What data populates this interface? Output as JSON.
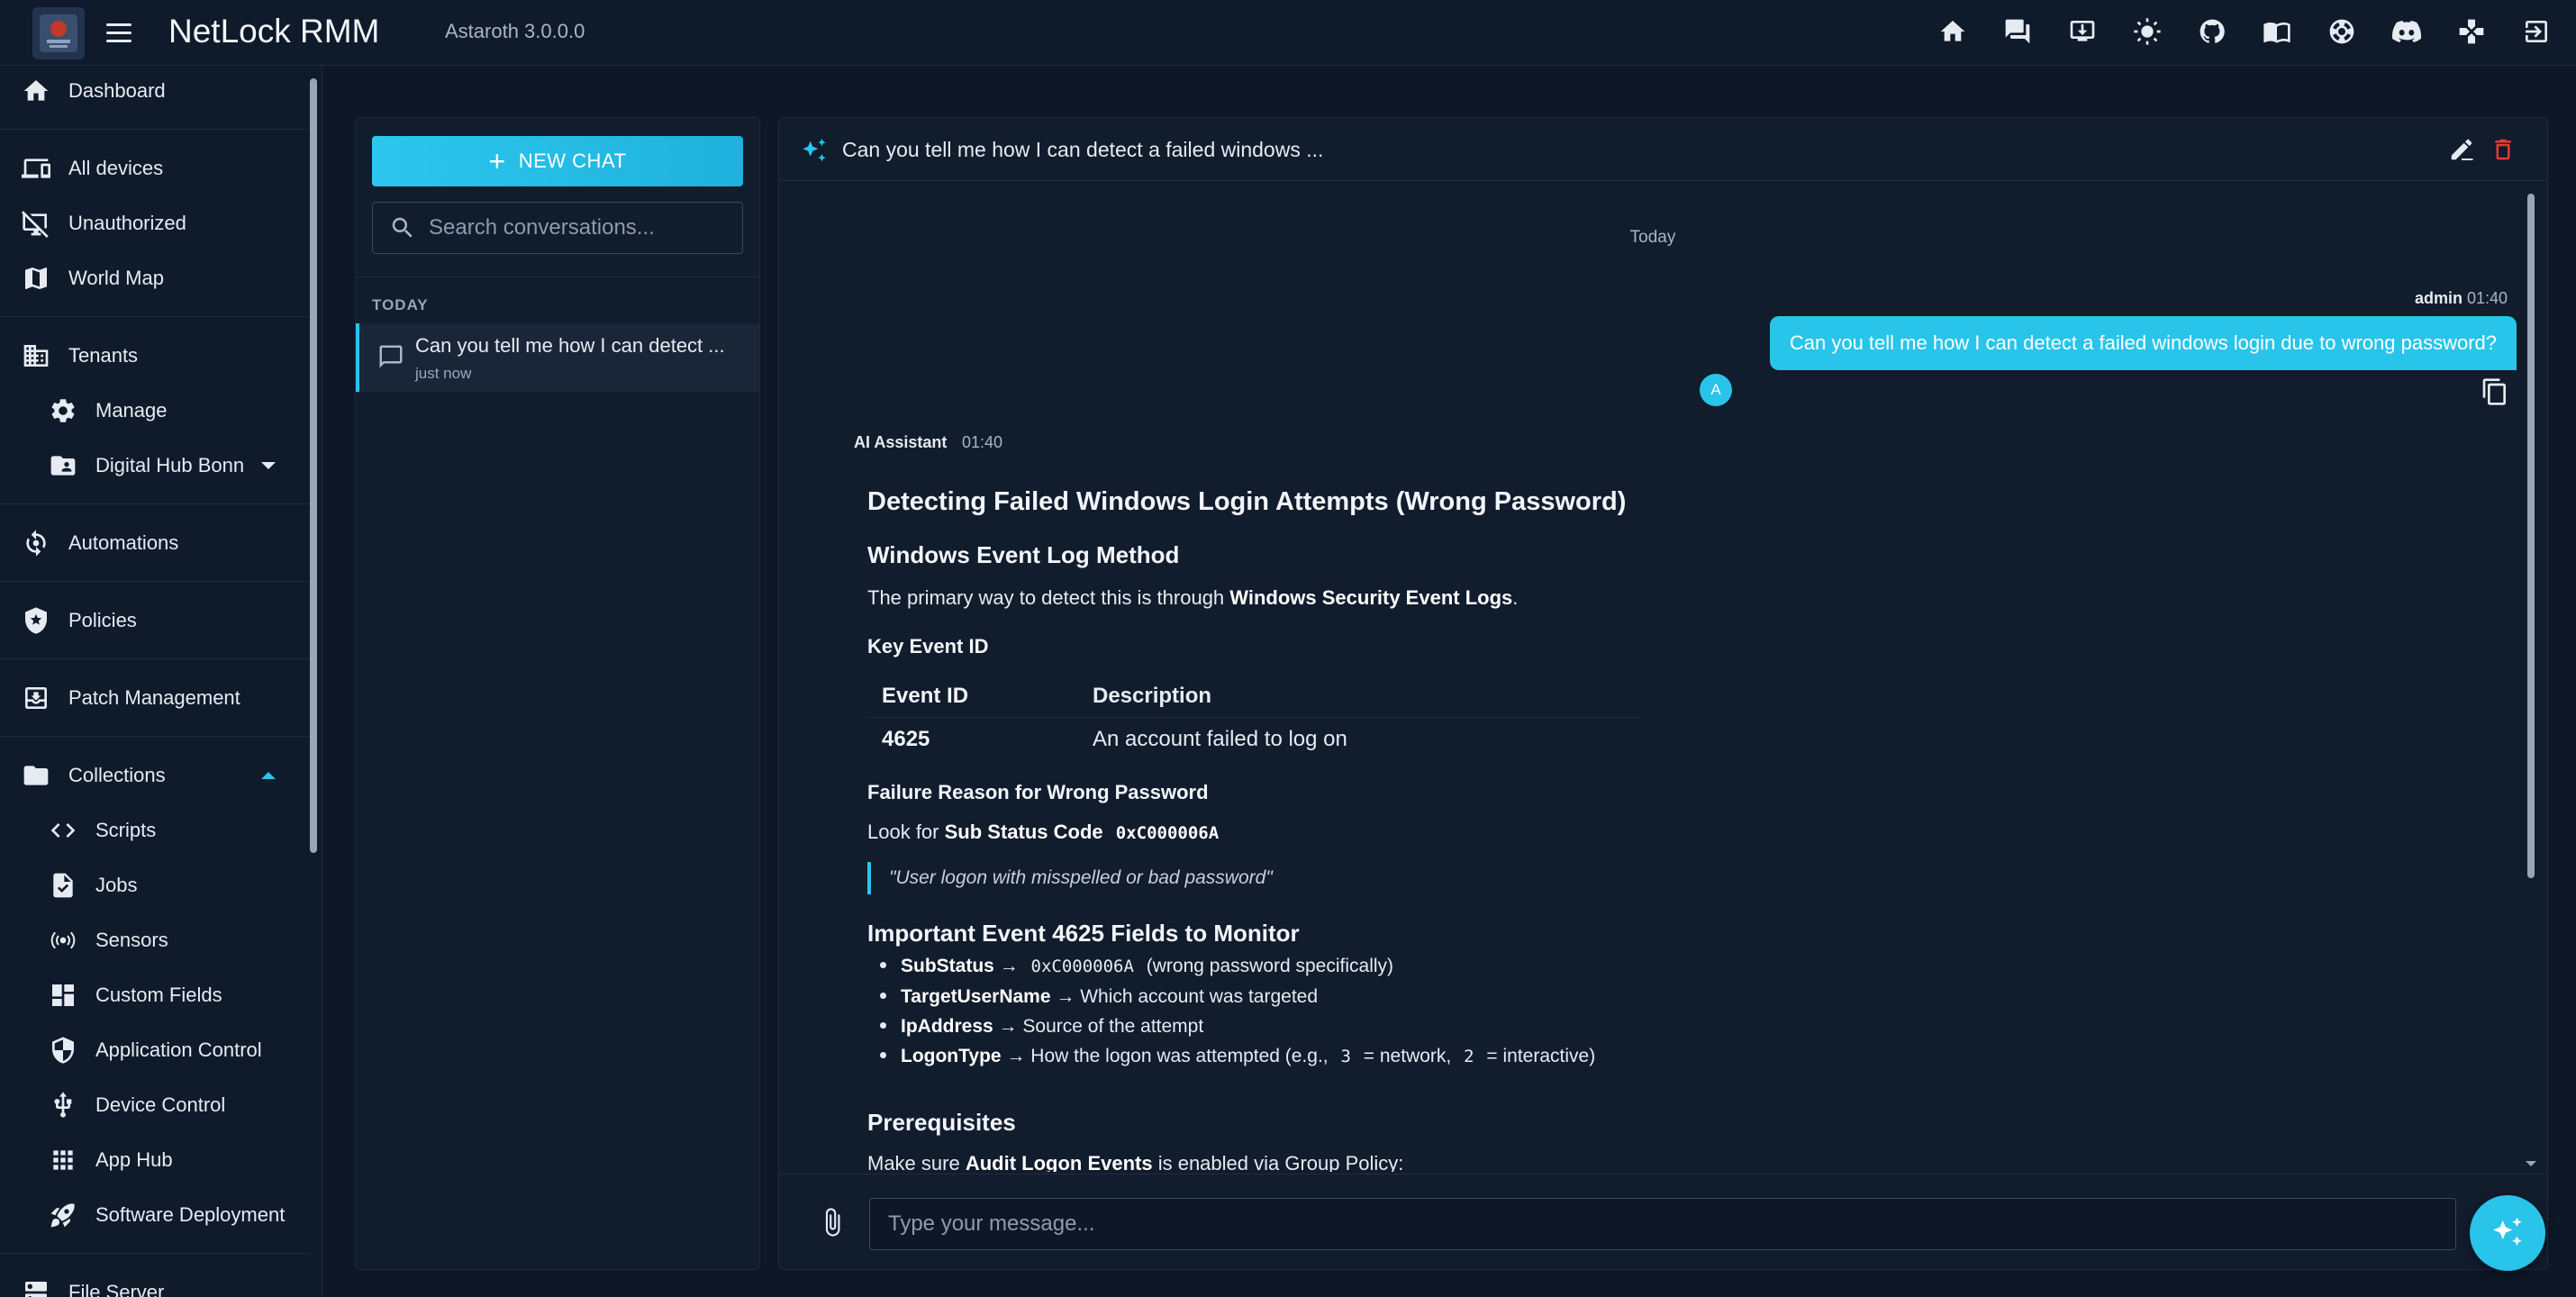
{
  "app": {
    "title": "NetLock RMM",
    "version": "Astaroth 3.0.0.0"
  },
  "topbar": {
    "icons": [
      "home-icon",
      "chat-icon",
      "download-icon",
      "theme-icon",
      "github-icon",
      "docs-icon",
      "support-icon",
      "discord-icon",
      "game-icon",
      "logout-icon"
    ]
  },
  "sidebar": {
    "items": [
      {
        "label": "Dashboard",
        "icon": "home-icon"
      },
      {
        "label": "All devices",
        "icon": "devices-icon"
      },
      {
        "label": "Unauthorized",
        "icon": "unauthorized-icon"
      },
      {
        "label": "World Map",
        "icon": "map-icon"
      },
      {
        "label": "Tenants",
        "icon": "building-icon"
      },
      {
        "label": "Manage",
        "icon": "gear-icon"
      },
      {
        "label": "Digital Hub Bonn",
        "icon": "folder-user-icon"
      },
      {
        "label": "Automations",
        "icon": "automation-icon"
      },
      {
        "label": "Policies",
        "icon": "shield-star-icon"
      },
      {
        "label": "Patch Management",
        "icon": "patch-icon"
      },
      {
        "label": "Collections",
        "icon": "folder-icon"
      },
      {
        "label": "Scripts",
        "icon": "code-icon"
      },
      {
        "label": "Jobs",
        "icon": "job-icon"
      },
      {
        "label": "Sensors",
        "icon": "sensor-icon"
      },
      {
        "label": "Custom Fields",
        "icon": "grid-icon"
      },
      {
        "label": "Application Control",
        "icon": "app-control-icon"
      },
      {
        "label": "Device Control",
        "icon": "usb-icon"
      },
      {
        "label": "App Hub",
        "icon": "apps-icon"
      },
      {
        "label": "Software Deployment",
        "icon": "rocket-icon"
      },
      {
        "label": "File Server",
        "icon": "server-icon"
      }
    ]
  },
  "conversations": {
    "new_chat_label": "NEW CHAT",
    "search_placeholder": "Search conversations...",
    "group_label": "TODAY",
    "items": [
      {
        "title": "Can you tell me how I can detect ...",
        "time": "just now"
      }
    ]
  },
  "chat": {
    "title": "Can you tell me how I can detect a failed windows ...",
    "day_label": "Today",
    "user_message": {
      "sender": "admin",
      "time": "01:40",
      "text": "Can you tell me how I can detect a failed windows login due to wrong password?",
      "avatar": "A"
    },
    "ai_message": {
      "sender": "AI Assistant",
      "time": "01:40",
      "heading": "Detecting Failed Windows Login Attempts (Wrong Password)",
      "section1_title": "Windows Event Log Method",
      "section1_text_a": "The primary way to detect this is through ",
      "section1_text_b": "Windows Security Event Logs",
      "section1_text_c": ".",
      "key_event_title": "Key Event ID",
      "table_headers": [
        "Event ID",
        "Description"
      ],
      "table_rows": [
        [
          "4625",
          "An account failed to log on"
        ]
      ],
      "failure_title": "Failure Reason for Wrong Password",
      "failure_text_a": "Look for ",
      "failure_text_b": "Sub Status Code",
      "failure_code": "0xC000006A",
      "quote": "\"User logon with misspelled or bad password\"",
      "fields_title": "Important Event 4625 Fields to Monitor",
      "fields": [
        {
          "name": "SubStatus",
          "arrow": "→",
          "code": "0xC000006A",
          "text": "(wrong password specifically)"
        },
        {
          "name": "TargetUserName",
          "arrow": "→",
          "text": "Which account was targeted"
        },
        {
          "name": "IpAddress",
          "arrow": "→",
          "text": "Source of the attempt"
        },
        {
          "name": "LogonType",
          "arrow": "→",
          "text_a": "How the logon was attempted (e.g.,",
          "code_a": "3",
          "text_b": "= network,",
          "code_b": "2",
          "text_c": "= interactive)"
        }
      ],
      "prereq_title": "Prerequisites",
      "prereq_text_a": "Make sure ",
      "prereq_text_b": "Audit Logon Events",
      "prereq_text_c": " is enabled via Group Policy:"
    },
    "input_placeholder": "Type your message..."
  },
  "colors": {
    "accent": "#29c4ea",
    "background": "#0e1726",
    "panel": "#111c2d",
    "danger": "#e53935"
  }
}
